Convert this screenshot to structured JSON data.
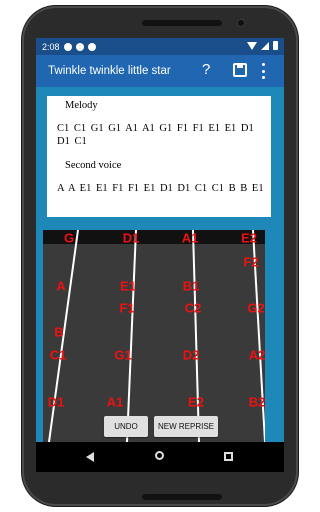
{
  "status": {
    "time": "2:08"
  },
  "appbar": {
    "title": "Twinkle twinkle little star",
    "help_icon": "?"
  },
  "melody": {
    "heading": "Melody",
    "notes": "C1  C1  G1  G1  A1  A1  G1  F1  F1  E1  E1  D1  D1  C1"
  },
  "second_voice": {
    "heading": "Second voice",
    "notes": "A  A  E1  E1  F1  F1  E1  D1  D1  C1  C1  B  B  E1"
  },
  "board": {
    "colors": {
      "background": "#3a3a3a",
      "label": "#ee1111",
      "lines": "#ffffff"
    },
    "labels": [
      "G",
      "D1",
      "A1",
      "E2",
      "F2",
      "A",
      "E1",
      "B1",
      "F1",
      "C2",
      "G2",
      "B",
      "C1",
      "G1",
      "D2",
      "A2",
      "D1",
      "A1",
      "E2",
      "B2"
    ]
  },
  "buttons": {
    "undo": "UNDO",
    "new_reprise": "NEW REPRISE"
  }
}
